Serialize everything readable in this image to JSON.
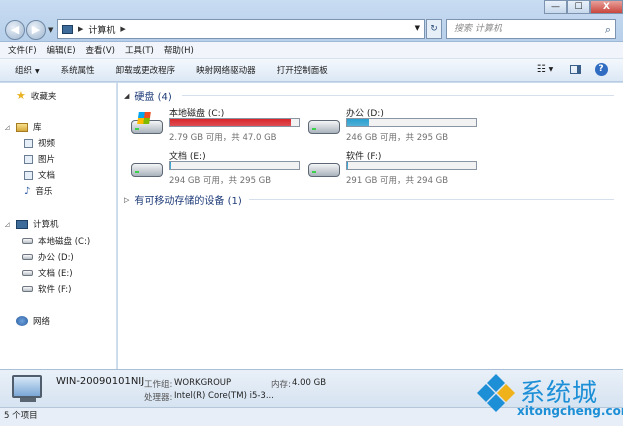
{
  "window": {
    "controls": {
      "minimize": "—",
      "maximize": "☐",
      "close": "X"
    },
    "nav": {
      "back": "◀",
      "forward": "▶"
    },
    "address": {
      "separator": "▶",
      "crumb": "计算机",
      "trailing_separator": "▶"
    },
    "search_placeholder": "搜索 计算机"
  },
  "menu": [
    "文件(F)",
    "编辑(E)",
    "查看(V)",
    "工具(T)",
    "帮助(H)"
  ],
  "toolbar": {
    "items": [
      "组织",
      "系统属性",
      "卸载或更改程序",
      "映射网络驱动器",
      "打开控制面板"
    ],
    "organize_arrow": "▼",
    "views_icon": "view-options-icon",
    "help_label": "?"
  },
  "navpane": {
    "favorites": "收藏夹",
    "libraries": "库",
    "library_items": [
      "视频",
      "图片",
      "文档",
      "音乐"
    ],
    "computer": "计算机",
    "drives": [
      "本地磁盘 (C:)",
      "办公 (D:)",
      "文档 (E:)",
      "软件 (F:)"
    ],
    "network": "网络"
  },
  "content": {
    "hard_disks_header": "硬盘 (4)",
    "removable_header": "有可移动存储的设备 (1)",
    "drives": [
      {
        "name": "本地磁盘 (C:)",
        "info": "2.79 GB 可用，共 47.0 GB",
        "used_fraction": 0.94,
        "color": "#d8252b",
        "system": true
      },
      {
        "name": "办公 (D:)",
        "info": "246 GB 可用，共 295 GB",
        "used_fraction": 0.17,
        "color": "#2aa0cf",
        "system": false
      },
      {
        "name": "文档 (E:)",
        "info": "294 GB 可用，共 295 GB",
        "used_fraction": 0.005,
        "color": "#2aa0cf",
        "system": false
      },
      {
        "name": "软件 (F:)",
        "info": "291 GB 可用，共 294 GB",
        "used_fraction": 0.01,
        "color": "#2aa0cf",
        "system": false
      }
    ]
  },
  "details": {
    "computer_name": "WIN-20090101NIJ",
    "workgroup_label": "工作组:",
    "workgroup_value": "WORKGROUP",
    "memory_label": "内存:",
    "memory_value": "4.00 GB",
    "processor_label": "处理器:",
    "processor_value": "Intel(R) Core(TM) i5-3..."
  },
  "status": "5 个项目",
  "watermark": {
    "title": "系统城",
    "subtitle": "xitongcheng.com"
  }
}
